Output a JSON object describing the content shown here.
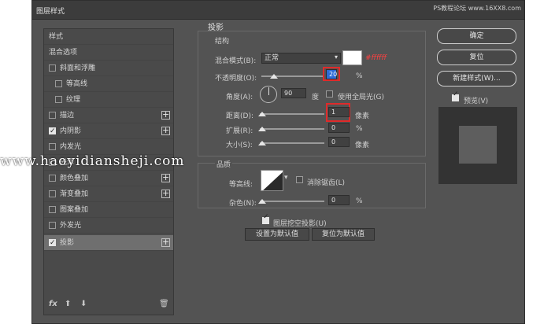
{
  "dialog": {
    "title": "图层样式"
  },
  "watermark": "PS教程论坛 www.16XX8.com",
  "overlay_url": "www.haoyidiansheji.com",
  "left_panel": {
    "header": "样式",
    "blend_options": "混合选项",
    "items": [
      {
        "label": "斜面和浮雕",
        "checked": false
      },
      {
        "label": "等高线",
        "checked": false
      },
      {
        "label": "纹理",
        "checked": false
      },
      {
        "label": "描边",
        "checked": false
      },
      {
        "label": "内阴影",
        "checked": true
      },
      {
        "label": "内发光",
        "checked": false
      },
      {
        "label": "光泽",
        "checked": false
      },
      {
        "label": "颜色叠加",
        "checked": false
      },
      {
        "label": "渐变叠加",
        "checked": false
      },
      {
        "label": "图案叠加",
        "checked": false
      },
      {
        "label": "外发光",
        "checked": false
      },
      {
        "label": "投影",
        "checked": true
      }
    ],
    "footer": {
      "fx": "fx",
      "up": "⬆",
      "down": "⬇",
      "trash": "🗑"
    }
  },
  "shadow": {
    "section_title": "投影",
    "structure_title": "结构",
    "blend_mode_label": "混合模式(B):",
    "blend_mode_value": "正常",
    "color_annotation": "#ffffff",
    "opacity_label": "不透明度(O):",
    "opacity_value": "20",
    "opacity_unit": "%",
    "angle_label": "角度(A):",
    "angle_value": "90",
    "angle_unit": "度",
    "global_light_label": "使用全局光(G)",
    "distance_label": "距离(D):",
    "distance_value": "1",
    "distance_unit": "像素",
    "spread_label": "扩展(R):",
    "spread_value": "0",
    "spread_unit": "%",
    "size_label": "大小(S):",
    "size_value": "0",
    "size_unit": "像素",
    "quality_title": "品质",
    "contour_label": "等高线:",
    "antialias_label": "消除锯齿(L)",
    "noise_label": "杂色(N):",
    "noise_value": "0",
    "noise_unit": "%",
    "knockout_label": "图层挖空投影(U)",
    "make_default": "设置为默认值",
    "reset_default": "复位为默认值"
  },
  "right_panel": {
    "ok": "确定",
    "reset": "复位",
    "new_style": "新建样式(W)...",
    "preview_label": "预览(V)"
  }
}
